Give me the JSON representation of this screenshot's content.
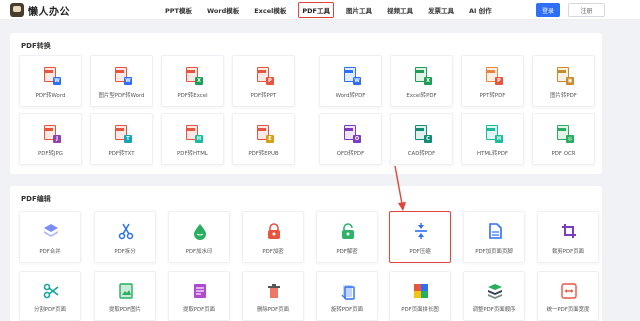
{
  "header": {
    "logo_text": "懒人办公",
    "nav": [
      "PPT模板",
      "Word模板",
      "Excel模板",
      "PDF工具",
      "图片工具",
      "视频工具",
      "发票工具",
      "AI 创作"
    ],
    "active_nav": "PDF工具",
    "login_label": "登录",
    "register_label": "注册"
  },
  "pdf_convert": {
    "title": "PDF转换",
    "tools": [
      {
        "label": "PDF转Word",
        "badge": "W",
        "badge_color": "#2f6ef5",
        "doc_color": "#e8553f"
      },
      {
        "label": "图片型PDF转Word",
        "badge": "W",
        "badge_color": "#2f6ef5",
        "doc_color": "#e8553f"
      },
      {
        "label": "PDF转Excel",
        "badge": "X",
        "badge_color": "#1f9d55",
        "doc_color": "#e8553f"
      },
      {
        "label": "PDF转PPT",
        "badge": "P",
        "badge_color": "#e8553f",
        "doc_color": "#e8553f"
      },
      {
        "label": "Word转PDF",
        "badge": "W",
        "badge_color": "#2f6ef5",
        "doc_color": "#2f6ef5"
      },
      {
        "label": "Excel转PDF",
        "badge": "X",
        "badge_color": "#1f9d55",
        "doc_color": "#1f9d55"
      },
      {
        "label": "PPT转PDF",
        "badge": "P",
        "badge_color": "#e8553f",
        "doc_color": "#e8883f"
      },
      {
        "label": "图片转PDF",
        "badge": "▣",
        "badge_color": "#c98b2c",
        "doc_color": "#c98b2c"
      },
      {
        "label": "PDF转JPG",
        "badge": "J",
        "badge_color": "#8e44ad",
        "doc_color": "#e8553f"
      },
      {
        "label": "PDF转TXT",
        "badge": "T",
        "badge_color": "#16a3b8",
        "doc_color": "#e8553f"
      },
      {
        "label": "PDF转HTML",
        "badge": "H",
        "badge_color": "#1abc9c",
        "doc_color": "#e8553f"
      },
      {
        "label": "PDF转EPUB",
        "badge": "E",
        "badge_color": "#d4a017",
        "doc_color": "#e8553f"
      },
      {
        "label": "OFD转PDF",
        "badge": "O",
        "badge_color": "#7d3cbd",
        "doc_color": "#7d3cbd"
      },
      {
        "label": "CAD转PDF",
        "badge": "C",
        "badge_color": "#138d75",
        "doc_color": "#138d75"
      },
      {
        "label": "HTML转PDF",
        "badge": "H",
        "badge_color": "#1abc9c",
        "doc_color": "#1abc9c"
      },
      {
        "label": "PDF OCR",
        "badge": "◎",
        "badge_color": "#27ae60",
        "doc_color": "#27ae60"
      }
    ]
  },
  "pdf_edit": {
    "title": "PDF编辑",
    "highlighted": "PDF压缩",
    "tools": [
      {
        "label": "PDF合并",
        "icon": "layers-icon",
        "color": "#7b8cf2"
      },
      {
        "label": "PDF拆分",
        "icon": "scissors-icon",
        "color": "#2f6ef5"
      },
      {
        "label": "PDF加水印",
        "icon": "water-drop-icon",
        "color": "#27ae60"
      },
      {
        "label": "PDF加密",
        "icon": "lock-icon",
        "color": "#e8553f"
      },
      {
        "label": "PDF解密",
        "icon": "unlock-icon",
        "color": "#2fb36b"
      },
      {
        "label": "PDF压缩",
        "icon": "compress-icon",
        "color": "#2f6ef5"
      },
      {
        "label": "PDF加页面页脚",
        "icon": "page-icon",
        "color": "#2f6ef5"
      },
      {
        "label": "裁剪PDF页面",
        "icon": "crop-icon",
        "color": "#7d3cbd"
      },
      {
        "label": "分割PDF页面",
        "icon": "split-icon",
        "color": "#16a39a"
      },
      {
        "label": "提取PDF图片",
        "icon": "image-icon",
        "color": "#27ae60"
      },
      {
        "label": "提取PDF页面",
        "icon": "extract-icon",
        "color": "#b04ad1"
      },
      {
        "label": "删除PDF页面",
        "icon": "trash-icon",
        "color": "#e8553f"
      },
      {
        "label": "旋转PDF页面",
        "icon": "rotate-icon",
        "color": "#2f6ef5"
      },
      {
        "label": "PDF页面拼长图",
        "icon": "puzzle-icon",
        "color": "#e8553f"
      },
      {
        "label": "调整PDF页面顺序",
        "icon": "stack-icon",
        "color": "#2c3e50"
      },
      {
        "label": "统一PDF页面宽度",
        "icon": "width-icon",
        "color": "#e8553f"
      }
    ]
  },
  "colors": {
    "accent": "#2f6ef5",
    "highlight": "#e0443a"
  }
}
